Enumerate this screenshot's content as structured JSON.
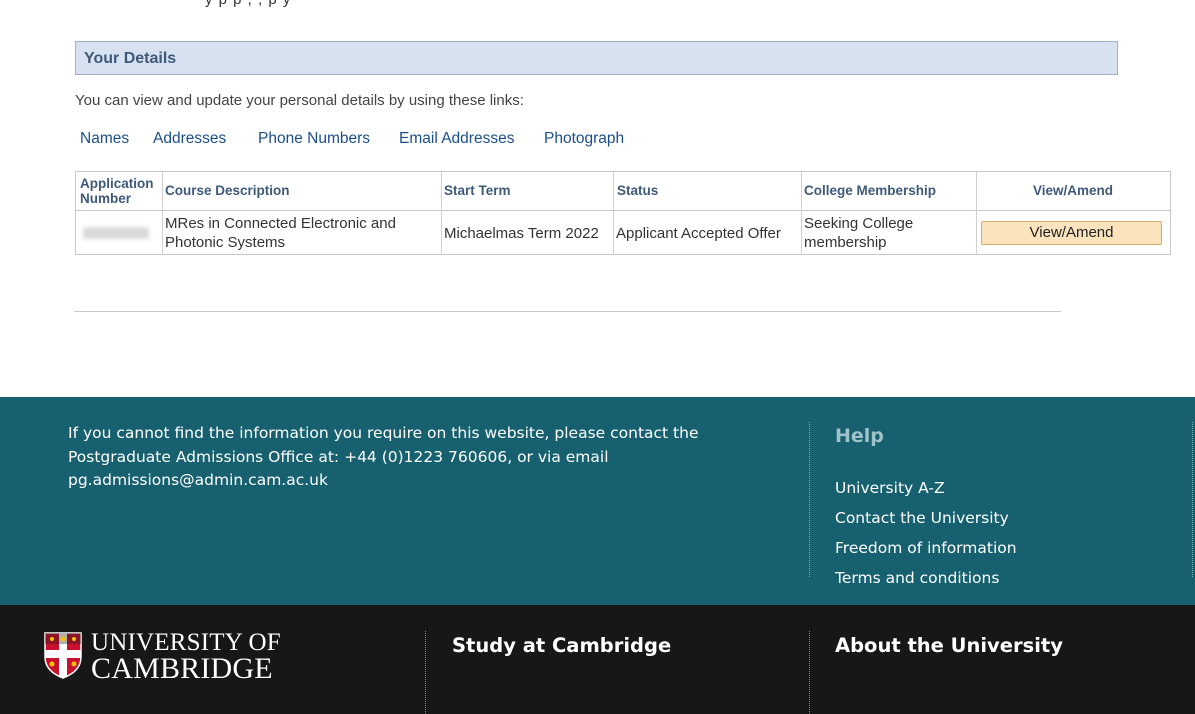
{
  "details": {
    "title": "Your Details",
    "intro": "You can view and update your personal details by using these links:",
    "links": [
      "Names",
      "Addresses",
      "Phone Numbers",
      "Email Addresses",
      "Photograph"
    ]
  },
  "applications": {
    "headers": {
      "app_number": "Application Number",
      "course": "Course Description",
      "start": "Start Term",
      "status": "Status",
      "college": "College Membership",
      "view": "View/Amend"
    },
    "rows": [
      {
        "course_line1": "MRes in Connected Electronic and",
        "course_line2": "Photonic Systems",
        "start": "Michaelmas Term 2022",
        "status": "Applicant Accepted Offer",
        "college_line1": "Seeking College",
        "college_line2": "membership",
        "button": "View/Amend"
      }
    ]
  },
  "footer": {
    "contact": "If you cannot find the information you require on this website, please contact the Postgraduate Admissions Office at: +44 (0)1223 760606, or via email pg.admissions@admin.cam.ac.uk",
    "help_title": "Help",
    "help_links": [
      "University A-Z",
      "Contact the University",
      "Freedom of information",
      "Terms and conditions"
    ],
    "logo_line1": "UNIVERSITY OF",
    "logo_line2": "CAMBRIDGE",
    "study_title": "Study at Cambridge",
    "about_title": "About the University"
  },
  "colors": {
    "teal": "#16606f",
    "dark": "#171717",
    "header_bg": "#d7e1ef",
    "link": "#1c4f8a",
    "button_bg": "#fbe3bd"
  },
  "icons": [
    "cambridge-shield-icon"
  ]
}
